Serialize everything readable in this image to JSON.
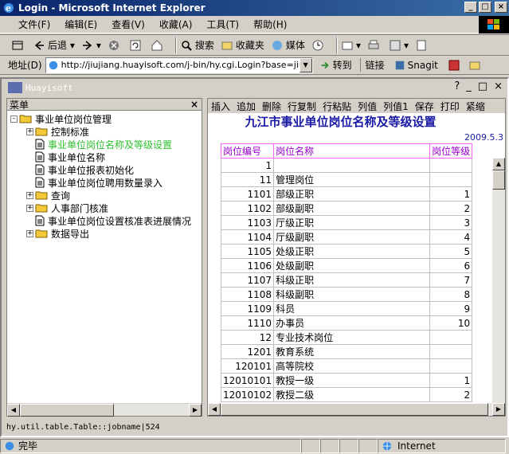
{
  "window": {
    "title": "Login - Microsoft Internet Explorer"
  },
  "menu": [
    "文件(F)",
    "编辑(E)",
    "查看(V)",
    "收藏(A)",
    "工具(T)",
    "帮助(H)"
  ],
  "toolbar": {
    "back": "后退",
    "search": "搜索",
    "favorites": "收藏夹",
    "media": "媒体"
  },
  "address": {
    "label": "地址(D)",
    "url": "http://jiujiang.huayisoft.com/j-bin/hy.cgi.Login?base=jiujiang",
    "go": "转到",
    "links": "链接",
    "snagit": "Snagit"
  },
  "applet": {
    "name": "Huayisoft",
    "controls": [
      "?",
      "_",
      "□",
      "×"
    ]
  },
  "menu_pane": {
    "title": "菜单",
    "tree": [
      {
        "label": "事业单位岗位管理",
        "level": 0,
        "type": "folder-open",
        "exp": "-"
      },
      {
        "label": "控制标准",
        "level": 1,
        "type": "folder",
        "exp": "+"
      },
      {
        "label": "事业单位岗位名称及等级设置",
        "level": 1,
        "type": "doc",
        "active": true
      },
      {
        "label": "事业单位名称",
        "level": 1,
        "type": "doc"
      },
      {
        "label": "事业单位报表初始化",
        "level": 1,
        "type": "doc"
      },
      {
        "label": "事业单位岗位聘用数量录入",
        "level": 1,
        "type": "doc"
      },
      {
        "label": "查询",
        "level": 1,
        "type": "folder",
        "exp": "+"
      },
      {
        "label": "人事部门核准",
        "level": 1,
        "type": "folder",
        "exp": "+"
      },
      {
        "label": "事业单位岗位设置核准表进展情况",
        "level": 1,
        "type": "doc"
      },
      {
        "label": "数据导出",
        "level": 1,
        "type": "folder",
        "exp": "+"
      }
    ]
  },
  "report": {
    "actions": [
      "插入",
      "追加",
      "删除",
      "行复制",
      "行粘贴",
      "列值",
      "列值1",
      "保存",
      "打印",
      "紧缩"
    ],
    "title": "九江市事业单位岗位名称及等级设置",
    "date": "2009.5.3",
    "columns": [
      "岗位编号",
      "岗位名称",
      "岗位等级"
    ],
    "rows": [
      [
        "1",
        "",
        ""
      ],
      [
        "11",
        "管理岗位",
        ""
      ],
      [
        "1101",
        "部级正职",
        "1"
      ],
      [
        "1102",
        "部级副职",
        "2"
      ],
      [
        "1103",
        "厅级正职",
        "3"
      ],
      [
        "1104",
        "厅级副职",
        "4"
      ],
      [
        "1105",
        "处级正职",
        "5"
      ],
      [
        "1106",
        "处级副职",
        "6"
      ],
      [
        "1107",
        "科级正职",
        "7"
      ],
      [
        "1108",
        "科级副职",
        "8"
      ],
      [
        "1109",
        "科员",
        "9"
      ],
      [
        "1110",
        "办事员",
        "10"
      ],
      [
        "12",
        "专业技术岗位",
        ""
      ],
      [
        "1201",
        "教育系统",
        ""
      ],
      [
        "120101",
        "高等院校",
        ""
      ],
      [
        "12010101",
        "教授一级",
        "1"
      ],
      [
        "12010102",
        "教授二级",
        "2"
      ]
    ]
  },
  "status_line": "hy.util.table.Table::jobname|524",
  "ie_status": {
    "text": "完毕",
    "zone": "Internet"
  }
}
